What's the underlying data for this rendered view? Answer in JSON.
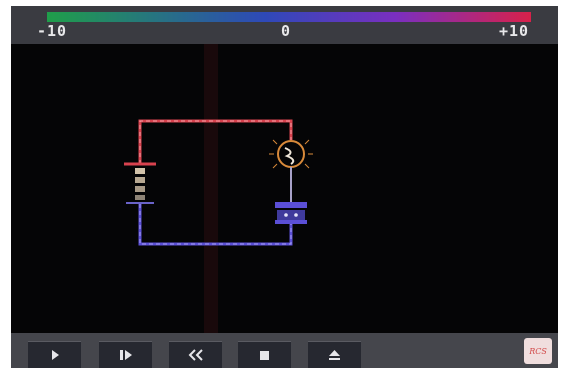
{
  "scale": {
    "min_label": "-10",
    "mid_label": "0",
    "max_label": "+10",
    "gradient_colors": [
      "#1f9e4a",
      "#2e49b8",
      "#7a2fc0",
      "#d8214a"
    ]
  },
  "controls": {
    "buttons": [
      {
        "name": "play-button",
        "icon": "play-icon"
      },
      {
        "name": "step-button",
        "icon": "step-forward-icon"
      },
      {
        "name": "rewind-button",
        "icon": "rewind-icon"
      },
      {
        "name": "stop-button",
        "icon": "stop-icon"
      },
      {
        "name": "eject-button",
        "icon": "eject-icon"
      }
    ],
    "logo_text": "RCS"
  },
  "circuit": {
    "positive_wire_color": "#d8424e",
    "negative_wire_color": "#5b4fd6",
    "battery_color": "#c7b9a4",
    "bulb_color": "#d98a3a"
  }
}
